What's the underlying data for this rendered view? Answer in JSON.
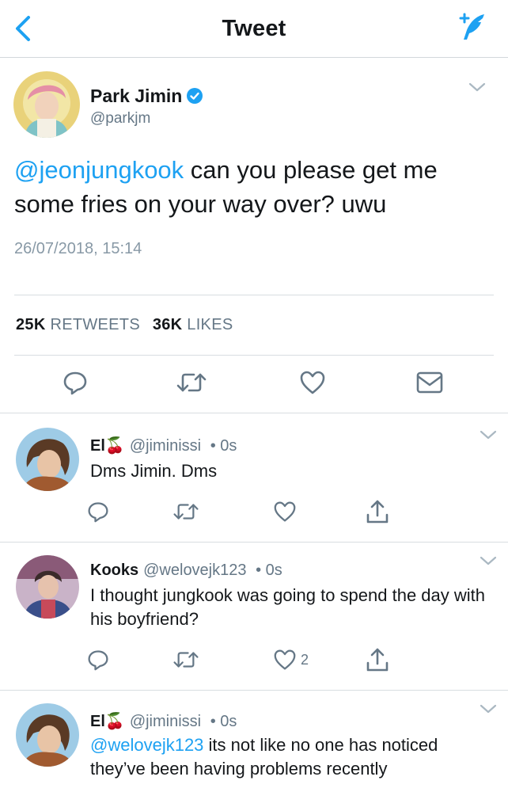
{
  "nav": {
    "title": "Tweet",
    "back_icon": "chevron-left-icon",
    "compose_icon": "compose-tweet-icon",
    "accent": "#1da1f2"
  },
  "tweet": {
    "author_name": "Park Jimin",
    "handle": "@parkjm",
    "mention": "@jeonjungkook",
    "text": " can you please get me some fries on your way over? uwu",
    "timestamp": "26/07/2018, 15:14",
    "retweets_count": "25K",
    "retweets_label": "RETWEETS",
    "likes_count": "36K",
    "likes_label": "LIKES"
  },
  "replies": [
    {
      "name": "El",
      "emoji": "🍒",
      "handle": "@jiminissi",
      "time": "0s",
      "mention": "",
      "text": "Dms Jimin. Dms",
      "likes": ""
    },
    {
      "name": "Kooks",
      "emoji": "",
      "handle": "@welovejk123",
      "time": "0s",
      "mention": "",
      "text": "I thought jungkook was going to spend the day with his boyfriend?",
      "likes": "2"
    },
    {
      "name": "El",
      "emoji": "🍒",
      "handle": "@jiminissi",
      "time": "0s",
      "mention": "@welovejk123",
      "text": " its not like no one has noticed they’ve been having problems recently",
      "likes": ""
    }
  ],
  "separator": "•"
}
